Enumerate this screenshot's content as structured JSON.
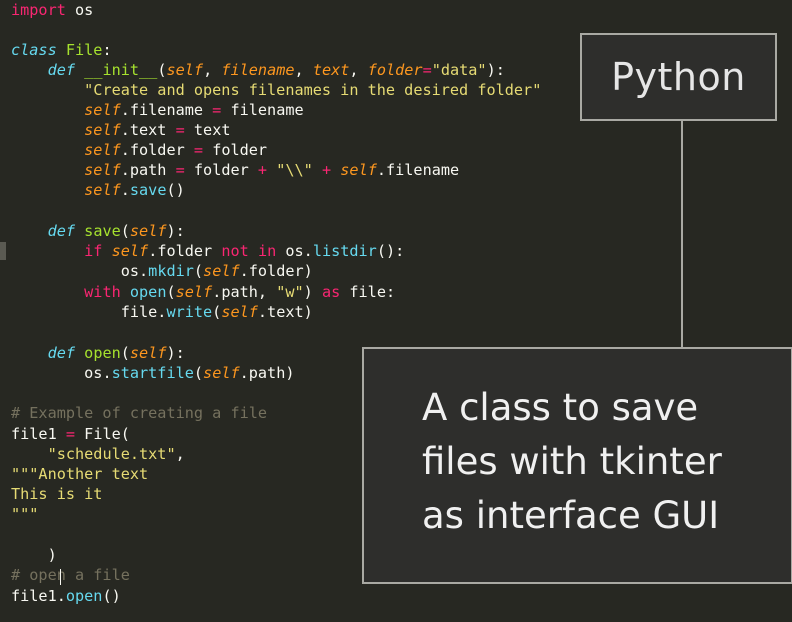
{
  "code": {
    "line_import": "import",
    "mod_os": " os",
    "kw_class": "class",
    "class_name": "File",
    "colon": ":",
    "kw_def": "def",
    "fn_init": "__init__",
    "p_open": "(",
    "p_close": ")",
    "self": "self",
    "comma": ", ",
    "param_filename": "filename",
    "param_text": "text",
    "param_folder": "folder",
    "eq": "=",
    "str_data": "\"data\"",
    "close_colon": "):",
    "docstring": "\"Create and opens filenames in the desired folder\"",
    "attr_filename": ".filename ",
    "val_filename": " filename",
    "attr_text": ".text ",
    "val_text": " text",
    "attr_folder": ".folder ",
    "val_folder": " folder",
    "attr_path": ".path ",
    "val_folder_plus": " folder ",
    "plus": "+",
    "str_backslash": "\"\\\\\"",
    "attr_filename_end": ".filename",
    "dot": ".",
    "call_save": "save",
    "empty_call": "()",
    "fn_save": "save",
    "kw_if": "if",
    "attr_folder_sp": ".folder ",
    "kw_not": "not",
    "kw_in": "in",
    "os_dot": " os.",
    "fn_listdir": "listdir",
    "call_close_colon": "():",
    "os_prefix": "os.",
    "fn_mkdir": "mkdir",
    "attr_folder_close": ".folder)",
    "kw_with": "with",
    "fn_open": "open",
    "attr_path_comma": ".path, ",
    "str_w": "\"w\"",
    "close_sp": ") ",
    "kw_as": "as",
    "file_colon": " file:",
    "file_dot": "file.",
    "fn_write": "write",
    "attr_text_close": ".text)",
    "fn_open_def": "open",
    "fn_startfile": "startfile",
    "attr_path_close": ".path)",
    "comment_example": "# Example of creating a file",
    "file1_assign": "file1 ",
    "file_call": " File(",
    "str_schedule": "\"schedule.txt\"",
    "trail_comma": ",",
    "str_triple_another": "\"\"\"Another text",
    "str_this": "This is it",
    "str_triple": "\"\"\"",
    "close_paren": ")",
    "comment_open": "# open a file",
    "file1_dot": "file1.",
    "fn_open_call": "open"
  },
  "overlay": {
    "tag_label": "Python",
    "caption_lines": [
      "A class to save",
      "files with tkinter",
      "as interface GUI"
    ]
  },
  "colors": {
    "background": "#272822",
    "keyword": "#f92672",
    "string": "#e6db74",
    "function": "#66d9ef",
    "class_name": "#a6e22e",
    "self_param": "#fd971f",
    "comment": "#75715e",
    "text": "#f8f8f2"
  }
}
